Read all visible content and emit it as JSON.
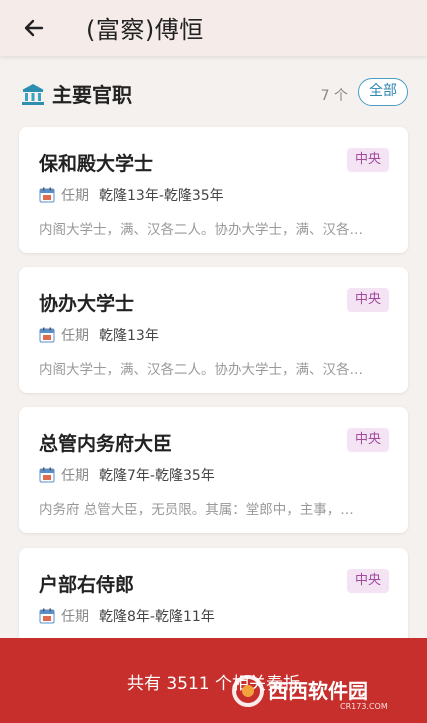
{
  "header": {
    "title": "(富察)傅恒"
  },
  "section": {
    "title": "主要官职",
    "count": "7 个",
    "all_label": "全部"
  },
  "cards": [
    {
      "name": "保和殿大学士",
      "tag": "中央",
      "term_label": "任期",
      "term": "乾隆13年-乾隆35年",
      "desc": "内阁大学士，满、汉各二人。协办大学士，满、汉各…"
    },
    {
      "name": "协办大学士",
      "tag": "中央",
      "term_label": "任期",
      "term": "乾隆13年",
      "desc": "内阁大学士，满、汉各二人。协办大学士，满、汉各…"
    },
    {
      "name": "总管内务府大臣",
      "tag": "中央",
      "term_label": "任期",
      "term": "乾隆7年-乾隆35年",
      "desc": "内务府 总管大臣，无员限。其属：堂郎中，主事，…"
    },
    {
      "name": "户部右侍郎",
      "tag": "中央",
      "term_label": "任期",
      "term": "乾隆8年-乾隆11年",
      "desc": ""
    }
  ],
  "bottom": {
    "text": "共有 3511 个相关奏折"
  },
  "watermark": {
    "text": "西西软件园",
    "sub": "CR173.COM"
  },
  "colors": {
    "accent": "#c62f2c",
    "tag_bg": "#f3e3f3",
    "tag_fg": "#a24a9e",
    "button": "#2f86b0"
  }
}
